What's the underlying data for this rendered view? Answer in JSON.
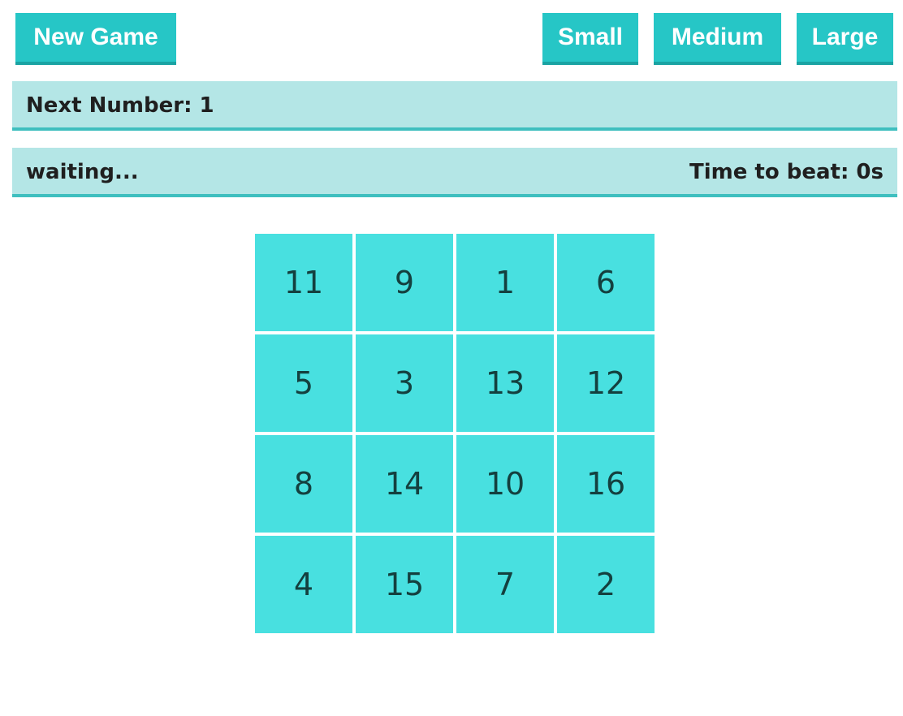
{
  "toolbar": {
    "new_game_label": "New Game",
    "sizes": [
      "Small",
      "Medium",
      "Large"
    ]
  },
  "status": {
    "next_number_text": "Next Number: 1",
    "state_text": "waiting...",
    "time_to_beat_text": "Time to beat: 0s"
  },
  "board": {
    "cells": [
      11,
      9,
      1,
      6,
      5,
      3,
      13,
      12,
      8,
      14,
      10,
      16,
      4,
      15,
      7,
      2
    ]
  },
  "colors": {
    "button": "#26c6c6",
    "panel": "#b4e6e6",
    "cell": "#48e0e0"
  }
}
